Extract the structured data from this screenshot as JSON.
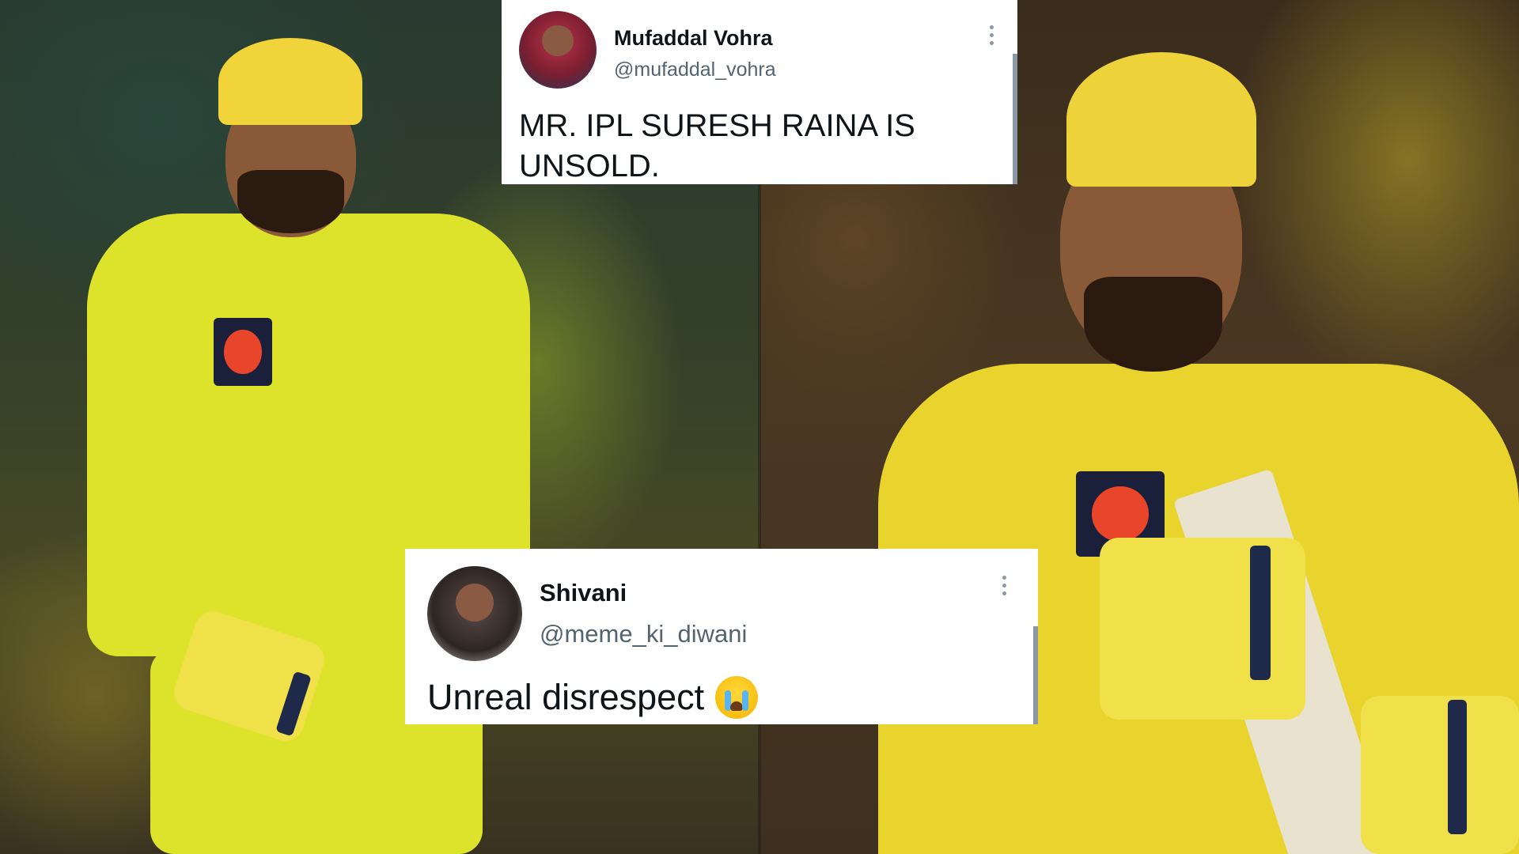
{
  "tweets": [
    {
      "display_name": "Mufaddal Vohra",
      "handle": "@mufaddal_vohra",
      "text": "MR. IPL SURESH RAINA IS UNSOLD."
    },
    {
      "display_name": "Shivani",
      "handle": "@meme_ki_diwani",
      "text": "Unreal disrespect",
      "emoji": "loudly-crying-face"
    }
  ],
  "colors": {
    "card_bg": "#ffffff",
    "text": "#0f1419",
    "secondary_text": "#536471",
    "jersey_yellow": "#dde32a"
  }
}
